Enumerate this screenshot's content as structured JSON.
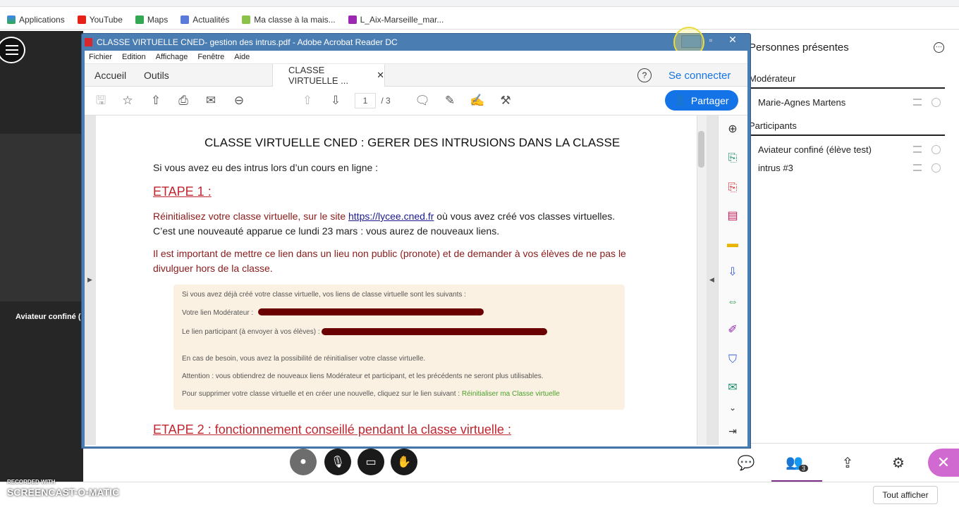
{
  "bookmarks": [
    "Applications",
    "YouTube",
    "Maps",
    "Actualités",
    "Ma classe à la mais...",
    "L_Aix-Marseille_mar..."
  ],
  "collab": {
    "camera_name": "Aviateur confiné (",
    "panel_title": "Personnes présentes",
    "moderator_section": "Modérateur",
    "participants_section": "Participants",
    "moderator": "Marie-Agnes Martens",
    "participants": [
      "Aviateur confiné (élève test)",
      "intrus #3"
    ],
    "participants_badge": "3"
  },
  "acrobat": {
    "title": "CLASSE VIRTUELLE CNED- gestion des intrus.pdf - Adobe Acrobat Reader DC",
    "menu": [
      "Fichier",
      "Edition",
      "Affichage",
      "Fenêtre",
      "Aide"
    ],
    "tabs": {
      "home": "Accueil",
      "tools": "Outils",
      "doc": "CLASSE VIRTUELLE ..."
    },
    "signin": "Se connecter",
    "share": "Partager",
    "page_current": "1",
    "page_total": "/ 3"
  },
  "doc": {
    "title": "CLASSE VIRTUELLE CNED : GERER DES INTRUSIONS  DANS LA CLASSE",
    "intro": "Si vous avez eu des intrus lors d’un cours en ligne :",
    "etape1": "ETAPE 1 :",
    "p1a": "Réinitialisez votre classe virtuelle, sur le site ",
    "p1link": "https://lycee.cned.fr",
    "p1b": "  où vous avez créé vos classes virtuelles.",
    "p2": "C’est une nouveauté apparue ce lundi 23 mars : vous aurez de nouveaux liens.",
    "p3a": "Il est important de mettre ce lien dans un lieu non public (pronote) et de demander à vos élèves de ne pas le",
    "p3b": "divulguer hors de la classe.",
    "shot": {
      "l1": "Si vous avez déjà créé votre classe virtuelle, vos liens de classe virtuelle sont les suivants :",
      "l2": "Votre lien Modérateur :",
      "l3": "Le lien participant (à envoyer à vos élèves) :",
      "l4": "En cas de besoin, vous avez la possibilité de réinitialiser votre classe virtuelle.",
      "l5": "Attention : vous obtiendrez de nouveaux liens Modérateur et participant, et les précédents ne seront plus utilisables.",
      "l6": "Pour supprimer votre classe virtuelle et en créer une nouvelle, cliquez sur le lien suivant : ",
      "link": "Réinitialiser ma Classe virtuelle"
    },
    "etape2": "ETAPE 2 : fonctionnement conseillé pendant la classe virtuelle :"
  },
  "footer": {
    "show_all": "Tout afficher",
    "watermark_top": "RECORDED WITH",
    "watermark": "SCREENCAST-O-MATIC"
  }
}
